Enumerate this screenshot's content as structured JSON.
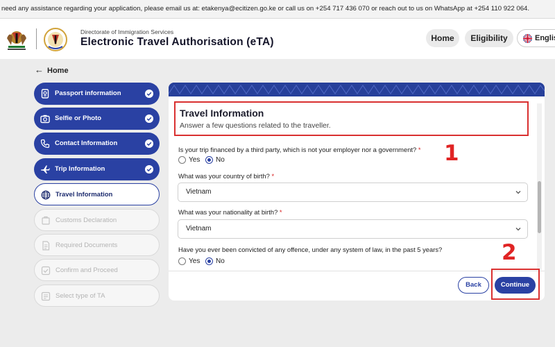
{
  "banner": {
    "text": "need any assistance regarding your application, please email us at: etakenya@ecitizen.go.ke or call us on +254 717 436 070 or reach out to us on WhatsApp at +254 110 922 064."
  },
  "header": {
    "department": "Directorate of Immigration Services",
    "title": "Electronic Travel Authorisation (eTA)",
    "nav": {
      "home": "Home",
      "eligibility": "Eligibility"
    },
    "language": "English"
  },
  "back_link": "Home",
  "steps": [
    {
      "label": "Passport information",
      "state": "done",
      "icon": "passport-icon"
    },
    {
      "label": "Selfie or Photo",
      "state": "done",
      "icon": "camera-icon"
    },
    {
      "label": "Contact Information",
      "state": "done",
      "icon": "phone-icon"
    },
    {
      "label": "Trip Information",
      "state": "done",
      "icon": "plane-icon"
    },
    {
      "label": "Travel Information",
      "state": "current",
      "icon": "globe-icon"
    },
    {
      "label": "Customs Declaration",
      "state": "pending",
      "icon": "customs-icon"
    },
    {
      "label": "Required Documents",
      "state": "pending",
      "icon": "document-icon"
    },
    {
      "label": "Confirm and Proceed",
      "state": "pending",
      "icon": "checkbox-icon"
    },
    {
      "label": "Select type of TA",
      "state": "pending",
      "icon": "select-icon"
    }
  ],
  "form": {
    "title": "Travel Information",
    "subtitle": "Answer a few questions related to the traveller.",
    "q1": {
      "text": "Is your trip financed by a third party, which is not your employer nor a government?",
      "required": "*",
      "yes": "Yes",
      "no": "No",
      "selected": "No"
    },
    "q2": {
      "text": "What was your country of birth?",
      "required": "*",
      "value": "Vietnam"
    },
    "q3": {
      "text": "What was your nationality at birth?",
      "required": "*",
      "value": "Vietnam"
    },
    "q4": {
      "text": "Have you ever been convicted of any offence, under any system of law, in the past 5 years?",
      "yes": "Yes",
      "no": "No",
      "selected": "No"
    }
  },
  "buttons": {
    "back": "Back",
    "continue": "Continue"
  },
  "annotations": {
    "marker1": "1",
    "marker2": "2"
  },
  "colors": {
    "primary": "#2a41a3",
    "annotation": "#d93030",
    "required": "#d92020"
  }
}
